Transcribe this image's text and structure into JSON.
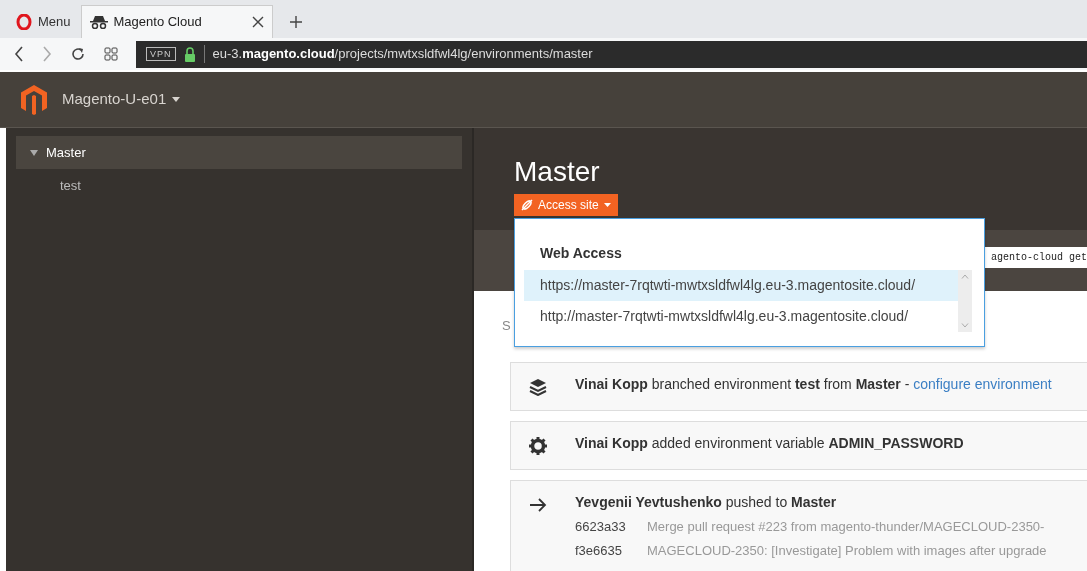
{
  "browser": {
    "menu_label": "Menu",
    "tab": {
      "title": "Magento Cloud",
      "selected": true
    },
    "vpn_badge": "VPN",
    "address": "eu-3.**magento.cloud**/projects/mwtxsldfwl4lg/environments/master"
  },
  "header": {
    "project": "Magento-U-e01"
  },
  "sidebar": {
    "items": [
      {
        "label": "Master",
        "expanded": true,
        "selected": true,
        "children": [
          {
            "label": "test",
            "selected": false
          }
        ]
      }
    ]
  },
  "environment": {
    "title": "Master",
    "access_button": "Access site",
    "cli_snippet": "agento-cloud get",
    "section_label": "S"
  },
  "access_menu": {
    "heading": "Web Access",
    "links": [
      {
        "url": "https://master-7rqtwti-mwtxsldfwl4lg.eu-3.magentosite.cloud/",
        "selected": true
      },
      {
        "url": "http://master-7rqtwti-mwtxsldfwl4lg.eu-3.magentosite.cloud/",
        "selected": false
      }
    ]
  },
  "activities": [
    {
      "kind": "branch",
      "text": "**Vinai Kopp** branched environment **test** from **Master** - ",
      "link": "configure environment"
    },
    {
      "kind": "variable",
      "text": "**Vinai Kopp** added environment variable **ADMIN_PASSWORD**"
    },
    {
      "kind": "push",
      "text": "**Yevgenii Yevtushenko** pushed to **Master**",
      "commits": [
        {
          "sha": "6623a33",
          "message": "Merge pull request #223 from magento-thunder/MAGECLOUD-2350-"
        },
        {
          "sha": "f3e6635",
          "message": "MAGECLOUD-2350: [Investigate] Problem with images after upgrade"
        }
      ]
    }
  ]
}
